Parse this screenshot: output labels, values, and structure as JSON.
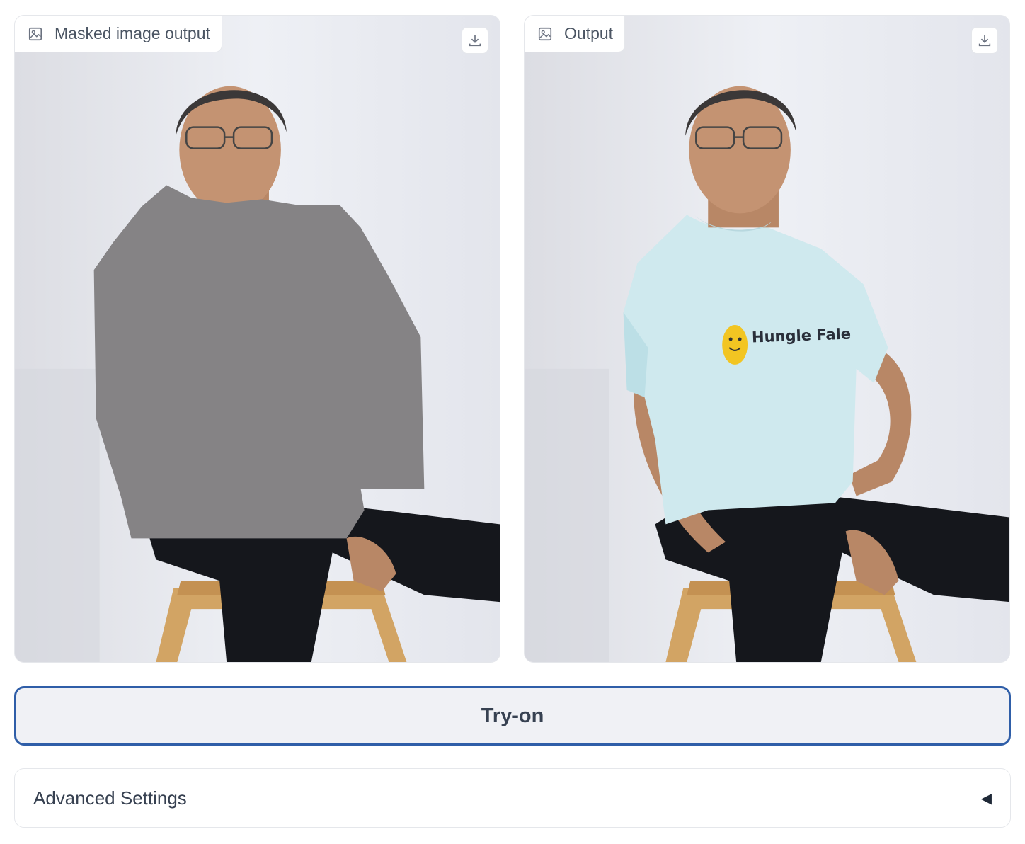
{
  "panels": {
    "left": {
      "label": "Masked image output",
      "label_icon": "image-icon",
      "action_icon": "download-icon"
    },
    "right": {
      "label": "Output",
      "label_icon": "image-icon",
      "action_icon": "download-icon"
    }
  },
  "shirt_print": {
    "text": "Hungle Fale"
  },
  "tryon_button": {
    "label": "Try-on"
  },
  "advanced": {
    "label": "Advanced Settings",
    "toggle_glyph": "◀"
  },
  "colors": {
    "accent_border": "#2f5ea8",
    "mask_gray": "#858385",
    "shirt": "#cfe9ee",
    "jeans": "#15171c"
  }
}
